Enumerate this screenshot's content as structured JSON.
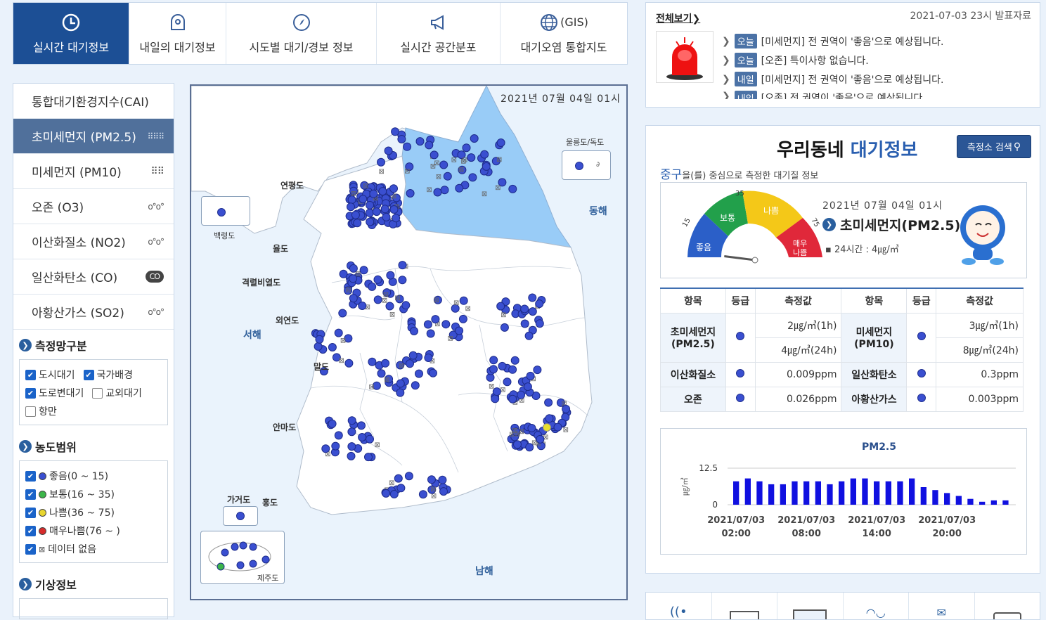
{
  "nav": {
    "tabs": [
      {
        "label": "실시간 대기정보",
        "icon": "clock-icon",
        "active": true
      },
      {
        "label": "내일의 대기정보",
        "icon": "forecast-icon",
        "active": false
      },
      {
        "label": "시도별 대기/경보 정보",
        "icon": "compass-icon",
        "active": false
      },
      {
        "label": "실시간 공간분포",
        "icon": "megaphone-icon",
        "active": false
      },
      {
        "label": "대기오염 통합지도",
        "icon": "globe-icon",
        "active": false,
        "suffix": "(GIS)"
      }
    ]
  },
  "sidebar": {
    "items": [
      {
        "label": "통합대기환경지수(CAI)",
        "icon": ""
      },
      {
        "label": "초미세먼지 (PM2.5)",
        "icon": "fine-dust-icon",
        "active": true
      },
      {
        "label": "미세먼지 (PM10)",
        "icon": "dust-icon"
      },
      {
        "label": "오존 (O3)",
        "icon": "ozone-icon"
      },
      {
        "label": "이산화질소 (NO2)",
        "icon": "no2-icon"
      },
      {
        "label": "일산화탄소 (CO)",
        "icon": "co-icon"
      },
      {
        "label": "아황산가스 (SO2)",
        "icon": "so2-icon"
      }
    ],
    "network_title": "측정망구분",
    "network": [
      {
        "label": "도시대기",
        "checked": true
      },
      {
        "label": "국가배경",
        "checked": true
      },
      {
        "label": "도로변대기",
        "checked": true
      },
      {
        "label": "교외대기",
        "checked": false
      },
      {
        "label": "항만",
        "checked": false
      }
    ],
    "range_title": "농도범위",
    "ranges": [
      {
        "label": "좋음(0 ~ 15)",
        "color": "#3a4fd0",
        "checked": true
      },
      {
        "label": "보통(16 ~ 35)",
        "color": "#3cb54a",
        "checked": true
      },
      {
        "label": "나쁨(36 ~ 75)",
        "color": "#e8d630",
        "checked": true
      },
      {
        "label": "매우나쁨(76 ~ )",
        "color": "#d62b2b",
        "checked": true
      },
      {
        "label": "데이터 없음",
        "color": "none",
        "checked": true
      }
    ],
    "weather_title": "기상정보"
  },
  "map": {
    "timestamp": "2021년 07월 04일 01시",
    "labels": {
      "ulleung": "울릉도/독도",
      "baengnyeong": "백령도",
      "yeonpyeong": "연평도",
      "yuldo": "율도",
      "gyeokryeol": "격렬비열도",
      "oeyeon": "외연도",
      "maldo": "말도",
      "anma": "안마도",
      "gageo": "가거도",
      "hongdo": "홍도",
      "jeju": "제주도",
      "east_sea": "동해",
      "west_sea": "서해",
      "south_sea": "남해"
    }
  },
  "notice": {
    "view_all": "전체보기",
    "issued": "2021-07-03 23시 발표자료",
    "items": [
      {
        "tag": "오늘",
        "text": "[미세먼지] 전 권역이 '좋음'으로 예상됩니다."
      },
      {
        "tag": "오늘",
        "text": "[오존] 특이사항 없습니다."
      },
      {
        "tag": "내일",
        "text": "[미세먼지] 전 권역이 '좋음'으로 예상됩니다."
      },
      {
        "tag": "내일",
        "text": "[오존] 전 권역이 '좋음'으로 예상됩니다."
      }
    ]
  },
  "hood": {
    "title_black": "우리동네",
    "title_blue": "대기정보",
    "search_button": "측정소 검색",
    "district": "중구",
    "district_suffix": "을(를) 중심으로 측정한 대기질 정보",
    "gauge": {
      "labels": [
        "좋음",
        "보통",
        "나쁨",
        "매우 나쁨"
      ],
      "ticks": [
        "15",
        "35",
        "75"
      ],
      "value": 4,
      "max": 100
    },
    "time": "2021년 07월 04일 01시",
    "pollutant": "초미세먼지(PM2.5)",
    "avg24": "24시간 : 4㎍/㎥",
    "table": {
      "headers": [
        "항목",
        "등급",
        "측정값",
        "항목",
        "등급",
        "측정값"
      ],
      "pm25_name": "초미세먼지 (PM2.5)",
      "pm25_1h": "2㎍/㎥(1h)",
      "pm25_24h": "4㎍/㎥(24h)",
      "pm10_name": "미세먼지 (PM10)",
      "pm10_1h": "3㎍/㎥(1h)",
      "pm10_24h": "8㎍/㎥(24h)",
      "no2_name": "이산화질소",
      "no2_val": "0.009ppm",
      "co_name": "일산화탄소",
      "co_val": "0.3ppm",
      "o3_name": "오존",
      "o3_val": "0.026ppm",
      "so2_name": "아황산가스",
      "so2_val": "0.003ppm"
    }
  },
  "chart_data": {
    "type": "bar",
    "title": "PM2.5",
    "ylabel": "㎍/㎥",
    "ylim": [
      0,
      12.5
    ],
    "yticks": [
      "12.5",
      "0"
    ],
    "xtick_labels": [
      {
        "date": "2021/07/03",
        "time": "02:00",
        "index": 0
      },
      {
        "date": "2021/07/03",
        "time": "08:00",
        "index": 6
      },
      {
        "date": "2021/07/03",
        "time": "14:00",
        "index": 12
      },
      {
        "date": "2021/07/03",
        "time": "20:00",
        "index": 18
      }
    ],
    "values": [
      8,
      9,
      8,
      7,
      7,
      8,
      8,
      8,
      7,
      8,
      9,
      9,
      8,
      8,
      8,
      9,
      6,
      5,
      4,
      3,
      2,
      1,
      1.5,
      1.5
    ],
    "color": "#1010e0"
  }
}
